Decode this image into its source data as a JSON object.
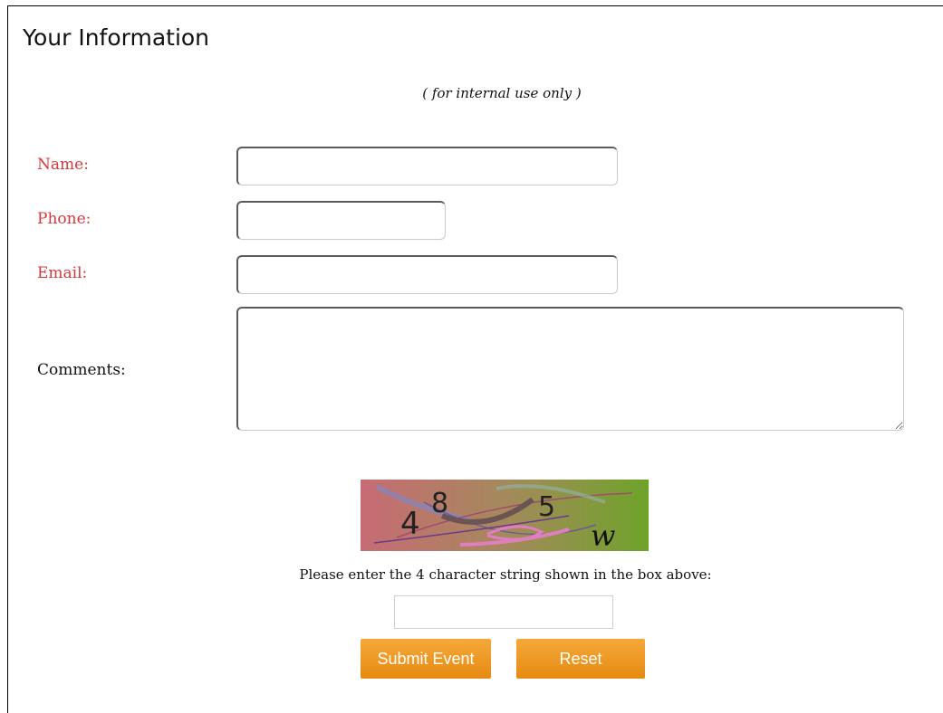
{
  "form": {
    "title": "Your Information",
    "subtitle": "( for internal use only )",
    "fields": {
      "name": {
        "label": "Name:",
        "value": ""
      },
      "phone": {
        "label": "Phone:",
        "value": ""
      },
      "email": {
        "label": "Email:",
        "value": ""
      },
      "comments": {
        "label": "Comments:",
        "value": ""
      }
    },
    "captcha": {
      "characters": [
        "4",
        "8",
        "5",
        "w"
      ],
      "prompt": "Please enter the 4 character string shown in the box above:",
      "value": ""
    },
    "buttons": {
      "submit": "Submit Event",
      "reset": "Reset"
    }
  },
  "colors": {
    "required_label": "#d8383a",
    "button": "#f0981f"
  }
}
